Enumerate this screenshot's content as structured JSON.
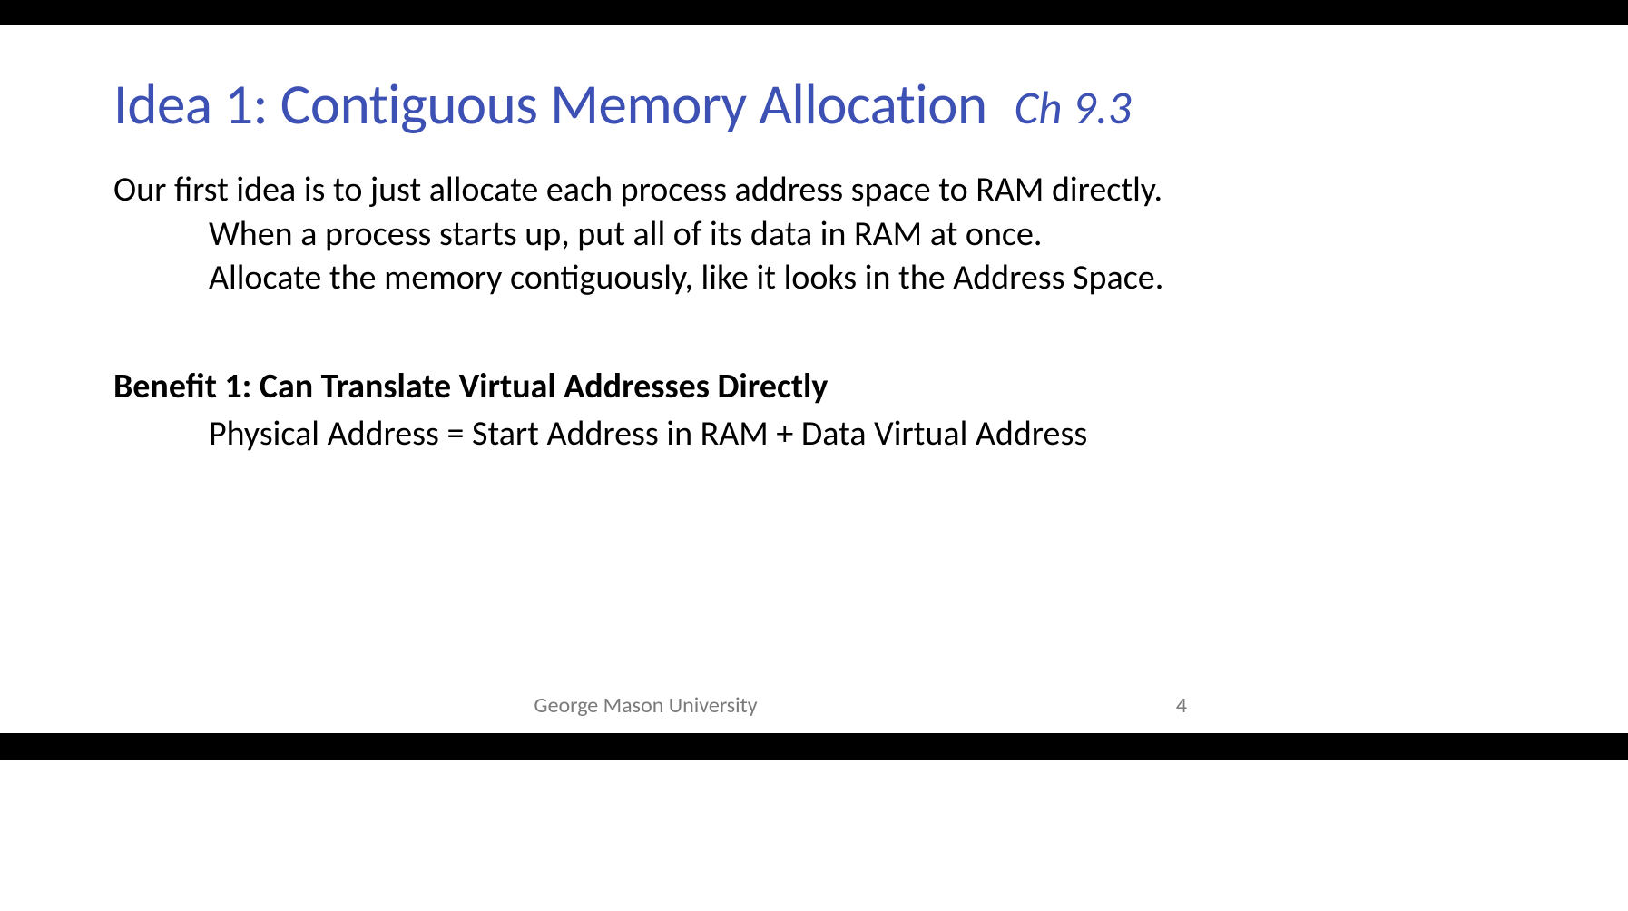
{
  "slide": {
    "title": "Idea 1: Contiguous Memory Allocation",
    "chapter": "Ch 9.3",
    "body": {
      "line1": "Our first idea is to just allocate each process address space to RAM directly.",
      "line2": "When a process starts up, put all of its data in RAM at once.",
      "line3": "Allocate the memory contiguously, like it looks in the Address Space."
    },
    "benefit": {
      "title": "Benefit 1: Can Translate Virtual Addresses Directly",
      "text": "Physical Address = Start Address in RAM + Data Virtual Address"
    },
    "footer": {
      "institution": "George Mason University",
      "page_number": "4"
    }
  }
}
